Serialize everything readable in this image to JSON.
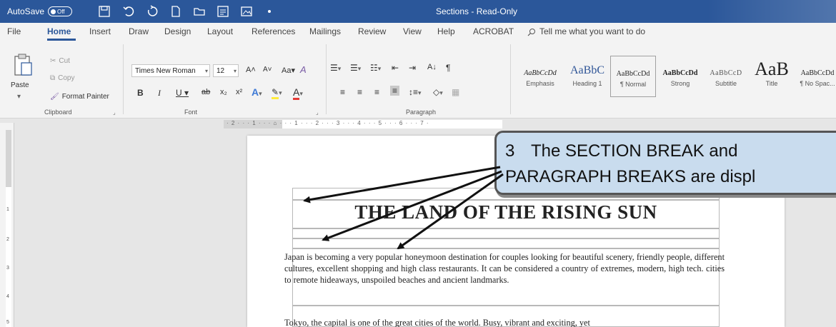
{
  "titlebar": {
    "autosave_label": "AutoSave",
    "autosave_state": "Off",
    "document_title": "Sections - Read-Only",
    "accent_color": "#2b579a"
  },
  "ribbon_tabs": [
    "File",
    "Home",
    "Insert",
    "Draw",
    "Design",
    "Layout",
    "References",
    "Mailings",
    "Review",
    "View",
    "Help",
    "ACROBAT"
  ],
  "tell_me": "Tell me what you want to do",
  "clipboard": {
    "paste": "Paste",
    "cut": "Cut",
    "copy": "Copy",
    "format_painter": "Format Painter",
    "group_label": "Clipboard"
  },
  "font": {
    "family": "Times New Roman",
    "size": "12",
    "group_label": "Font"
  },
  "paragraph": {
    "group_label": "Paragraph"
  },
  "styles": [
    {
      "sample": "AaBbCcDd",
      "name": "Emphasis"
    },
    {
      "sample": "AaBbC",
      "name": "Heading 1"
    },
    {
      "sample": "AaBbCcDd",
      "name": "¶ Normal"
    },
    {
      "sample": "AaBbCcDd",
      "name": "Strong"
    },
    {
      "sample": "AaBbCcD",
      "name": "Subtitle"
    },
    {
      "sample": "AaB",
      "name": "Title"
    },
    {
      "sample": "AaBbCcDd",
      "name": "¶ No Spac..."
    }
  ],
  "ruler": {
    "corner": "L",
    "horizontal": "· 2 · · · 1 · · · ⌂ · · · 1 · · · 2 · · · 3 · · · 4 · · · 5 · · · 6 · · · 7 ·",
    "vertical": [
      "1",
      "2",
      "3",
      "4",
      "5"
    ]
  },
  "document": {
    "heading": "THE LAND OF THE RISING SUN",
    "para1": "Japan is becoming a very popular honeymoon destination for couples looking for beautiful scenery, friendly people, different cultures, excellent shopping and high class restaurants. It can be considered a country of extremes, modern, high tech. cities to remote hideaways, unspoiled beaches and ancient landmarks.",
    "para2": "Tokyo, the capital is one of the great cities of the world. Busy, vibrant and exciting, yet"
  },
  "callout": {
    "number": "3",
    "line1": "The SECTION BREAK and",
    "line2": "PARAGRAPH BREAKS are displ"
  }
}
